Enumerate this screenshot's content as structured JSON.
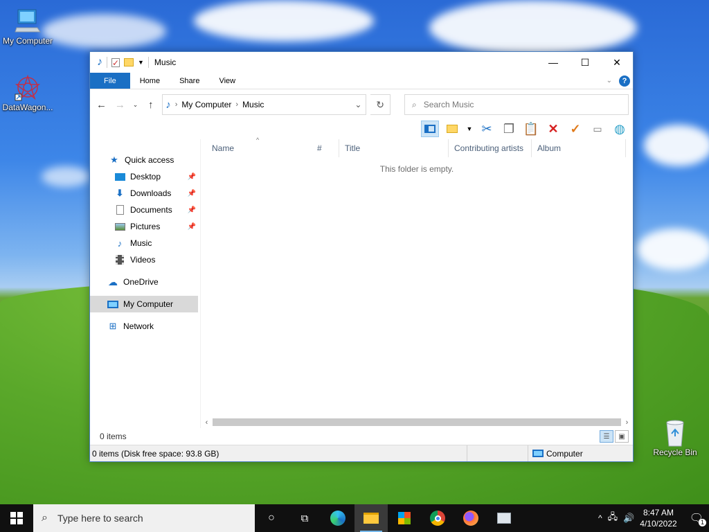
{
  "desktop": {
    "icons": [
      {
        "label": "My Computer"
      },
      {
        "label": "DataWagon..."
      },
      {
        "label": "Recycle Bin"
      }
    ]
  },
  "window": {
    "title": "Music",
    "ribbon_tabs": [
      "File",
      "Home",
      "Share",
      "View"
    ],
    "address": {
      "crumbs": [
        "My Computer",
        "Music"
      ]
    },
    "search_placeholder": "Search Music",
    "nav": {
      "quick_access": "Quick access",
      "pinned": [
        "Desktop",
        "Downloads",
        "Documents",
        "Pictures"
      ],
      "unpinned": [
        "Music",
        "Videos"
      ],
      "onedrive": "OneDrive",
      "my_computer": "My Computer",
      "network": "Network"
    },
    "columns": [
      "Name",
      "#",
      "Title",
      "Contributing artists",
      "Album"
    ],
    "empty_message": "This folder is empty.",
    "status_items": "0 items",
    "info_left": "0 items (Disk free space: 93.8 GB)",
    "info_right": "Computer"
  },
  "taskbar": {
    "search_placeholder": "Type here to search",
    "time": "8:47 AM",
    "date": "4/10/2022",
    "notification_count": "1"
  }
}
